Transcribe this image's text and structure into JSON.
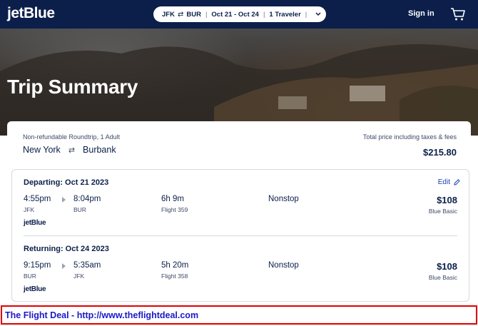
{
  "header": {
    "logo": "jetBlue",
    "search": {
      "origin": "JFK",
      "destination": "BUR",
      "dates": "Oct 21 - Oct 24",
      "travelers": "1 Traveler"
    },
    "signin_label": "Sign in",
    "icons": {
      "swap": "swap-arrows-icon",
      "dropdown": "chevron-down-icon",
      "cart": "cart-icon"
    }
  },
  "hero": {
    "title": "Trip Summary"
  },
  "summary": {
    "trip_type": "Non-refundable Roundtrip, 1 Adult",
    "origin_city": "New York",
    "destination_city": "Burbank",
    "total_label": "Total price including taxes & fees",
    "total_price": "$215.80"
  },
  "segments": [
    {
      "title": "Departing: Oct 21 2023",
      "edit_label": "Edit",
      "depart_time": "4:55pm",
      "depart_airport": "JFK",
      "arrive_time": "8:04pm",
      "arrive_airport": "BUR",
      "duration": "6h 9m",
      "flight": "Flight 359",
      "stops": "Nonstop",
      "price": "$108",
      "fare": "Blue Basic",
      "carrier": "jetBlue"
    },
    {
      "title": "Returning: Oct 24 2023",
      "depart_time": "9:15pm",
      "depart_airport": "BUR",
      "arrive_time": "5:35am",
      "arrive_airport": "JFK",
      "duration": "5h 20m",
      "flight": "Flight 358",
      "stops": "Nonstop",
      "price": "$108",
      "fare": "Blue Basic",
      "carrier": "jetBlue"
    }
  ],
  "banner": {
    "text": "The Flight Deal - http://www.theflightdeal.com"
  },
  "colors": {
    "navy": "#0b1f4a",
    "link_blue": "#1a3fb0",
    "banner_red": "#e00000",
    "banner_text": "#1a1ac8"
  }
}
